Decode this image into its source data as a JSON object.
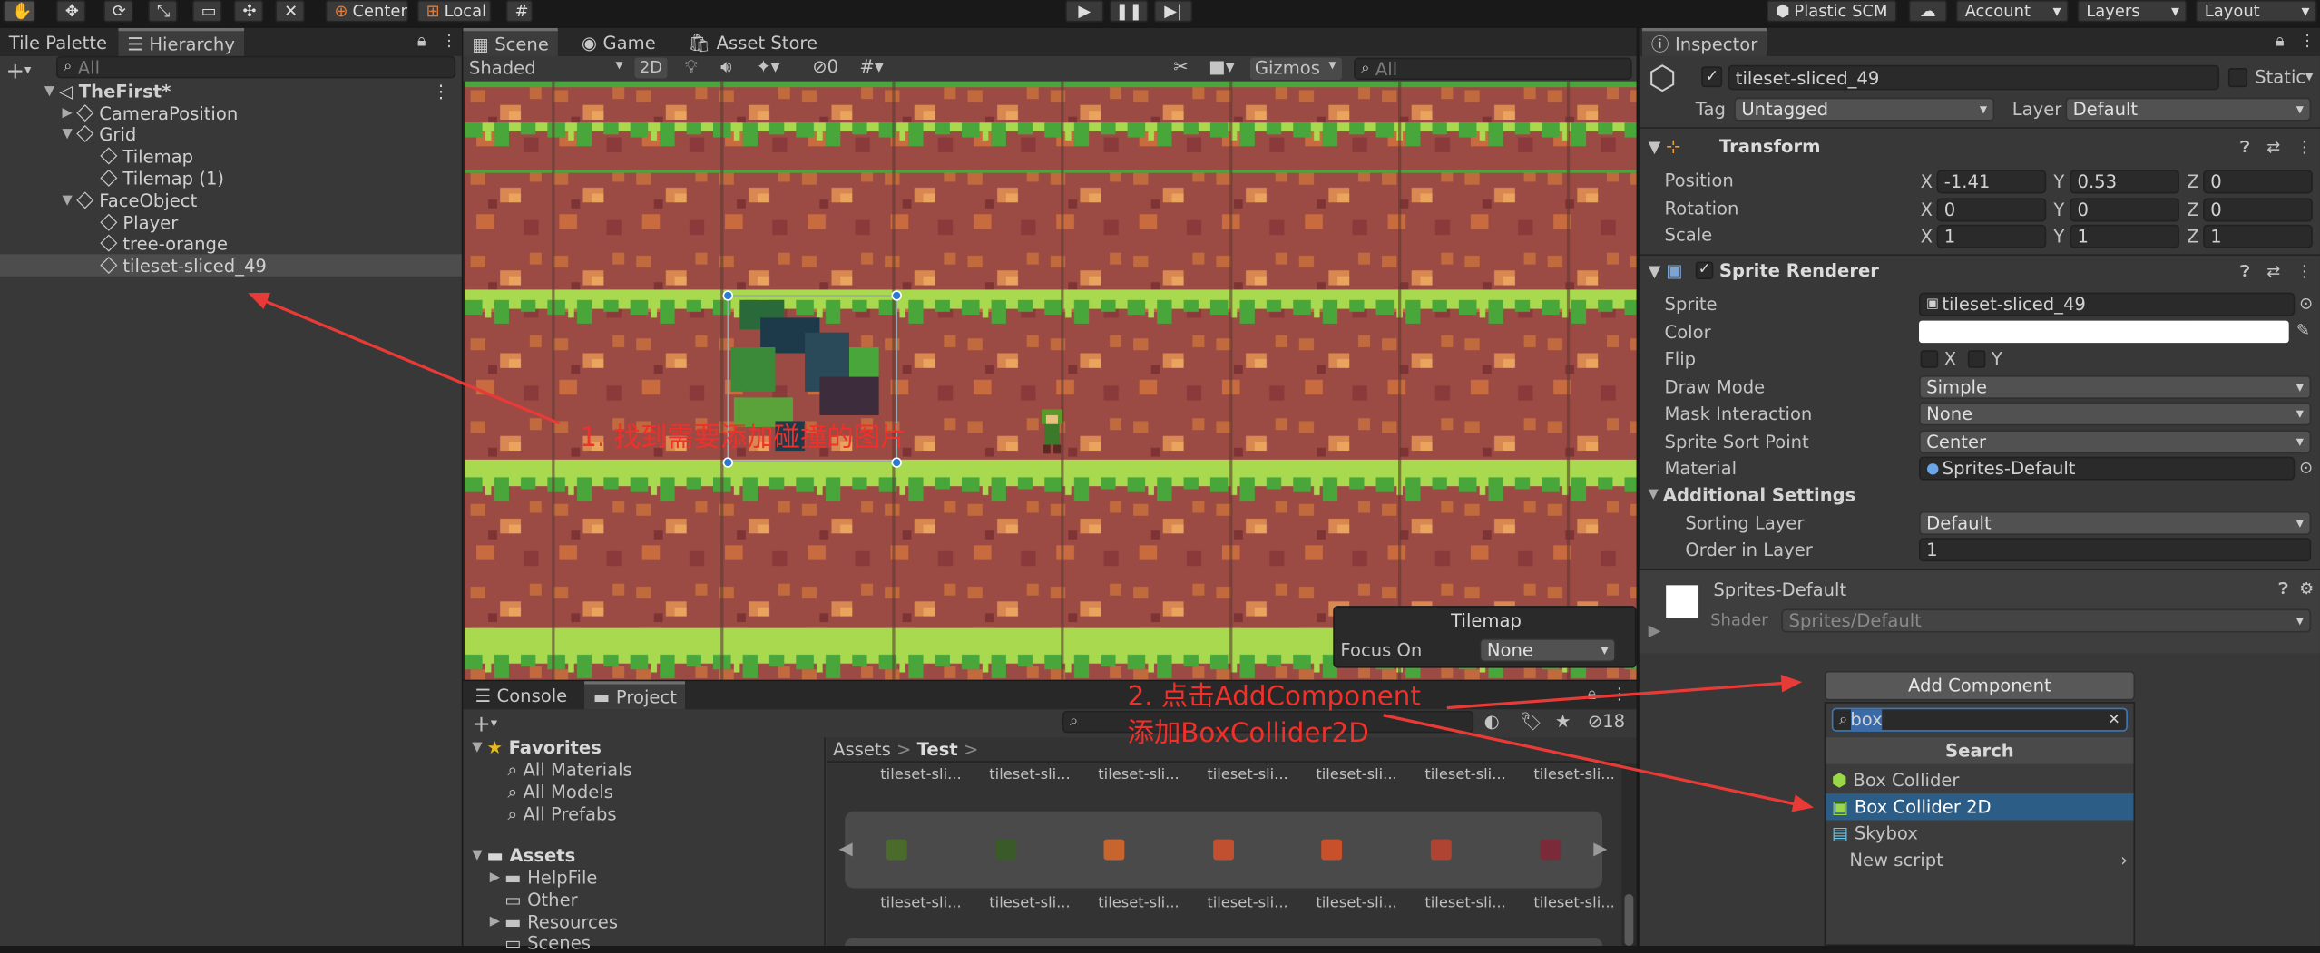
{
  "toolbar": {
    "pivot": "Center",
    "space": "Local",
    "plastic": "Plastic SCM",
    "account": "Account",
    "layers": "Layers",
    "layout": "Layout"
  },
  "left_tabs": {
    "tile_palette": "Tile Palette",
    "hierarchy": "Hierarchy"
  },
  "hierarchy": {
    "search_placeholder": "All",
    "scene_name": "TheFirst*",
    "items": [
      {
        "label": "CameraPosition"
      },
      {
        "label": "Grid"
      },
      {
        "label": "Tilemap"
      },
      {
        "label": "Tilemap (1)"
      },
      {
        "label": "FaceObject"
      },
      {
        "label": "Player"
      },
      {
        "label": "tree-orange"
      },
      {
        "label": "tileset-sliced_49"
      }
    ]
  },
  "scene_tabs": {
    "scene": "Scene",
    "game": "Game",
    "asset_store": "Asset Store"
  },
  "scene_toolbar": {
    "shading": "Shaded",
    "mode2d": "2D",
    "hidden_count": "0",
    "gizmos": "Gizmos",
    "search_placeholder": "All"
  },
  "tilemap_overlay": {
    "title": "Tilemap",
    "focus_label": "Focus On",
    "focus_value": "None"
  },
  "annotations": {
    "step1": "1. 找到需要添加碰撞的图片",
    "step2_line1": "2. 点击AddComponent",
    "step2_line2": "添加BoxCollider2D",
    "color": "#f0302a"
  },
  "bottom_tabs": {
    "console": "Console",
    "project": "Project",
    "hidden_count": "18"
  },
  "project": {
    "favorites_label": "Favorites",
    "favorites": [
      "All Materials",
      "All Models",
      "All Prefabs"
    ],
    "assets_label": "Assets",
    "assets": [
      "HelpFile",
      "Other",
      "Resources",
      "Scenes"
    ],
    "breadcrumb_root": "Assets",
    "breadcrumb_current": "Test",
    "thumb_label": "tileset-sli...",
    "thumb_colors": [
      "#4a6b2a",
      "#3a5a2a",
      "#c8642e",
      "#c05030",
      "#c8502a",
      "#b04432",
      "#7a2a38"
    ]
  },
  "inspector": {
    "tab": "Inspector",
    "object_name": "tileset-sliced_49",
    "static_label": "Static",
    "tag_label": "Tag",
    "tag_value": "Untagged",
    "layer_label": "Layer",
    "layer_value": "Default",
    "transform": {
      "title": "Transform",
      "position_label": "Position",
      "pos_x": "-1.41",
      "pos_y": "0.53",
      "pos_z": "0",
      "rotation_label": "Rotation",
      "rot_x": "0",
      "rot_y": "0",
      "rot_z": "0",
      "scale_label": "Scale",
      "scale_x": "1",
      "scale_y": "1",
      "scale_z": "1",
      "x": "X",
      "y": "Y",
      "z": "Z"
    },
    "sprite_renderer": {
      "title": "Sprite Renderer",
      "sprite_label": "Sprite",
      "sprite_value": "tileset-sliced_49",
      "color_label": "Color",
      "flip_label": "Flip",
      "flip_x": "X",
      "flip_y": "Y",
      "draw_mode_label": "Draw Mode",
      "draw_mode_value": "Simple",
      "mask_label": "Mask Interaction",
      "mask_value": "None",
      "sort_point_label": "Sprite Sort Point",
      "sort_point_value": "Center",
      "material_label": "Material",
      "material_value": "Sprites-Default",
      "additional_label": "Additional Settings",
      "sorting_layer_label": "Sorting Layer",
      "sorting_layer_value": "Default",
      "order_label": "Order in Layer",
      "order_value": "1"
    },
    "material_block": {
      "name": "Sprites-Default",
      "shader_label": "Shader",
      "shader_value": "Sprites/Default"
    },
    "add_component": {
      "button": "Add Component",
      "search_value": "box",
      "search_header": "Search",
      "results": [
        "Box Collider",
        "Box Collider 2D",
        "Skybox",
        "New script"
      ],
      "selected_index": 1
    }
  }
}
